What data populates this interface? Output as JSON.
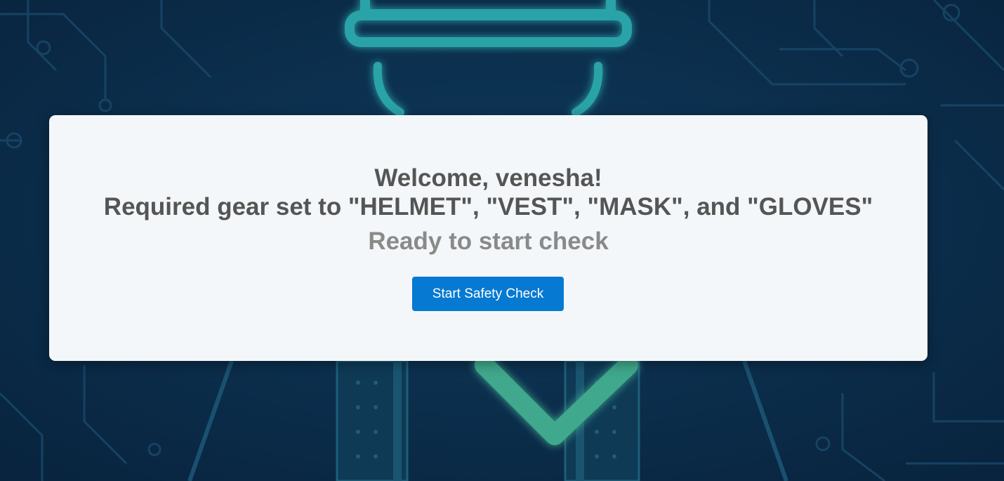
{
  "welcome_card": {
    "greeting": "Welcome, venesha!",
    "required_gear_message": "Required gear set to \"HELMET\", \"VEST\", \"MASK\", and \"GLOVES\"",
    "status_text": "Ready to start check",
    "start_button_label": "Start Safety Check"
  },
  "colors": {
    "background": "#0b2a47",
    "card_background": "#f4f7f9",
    "heading_text": "#555555",
    "status_text": "#8a8a8a",
    "button_background": "#0679d2",
    "button_text": "#ffffff",
    "glow_accent": "#2fb8b0"
  },
  "background_illustration": {
    "icon_name": "safety-worker-helmet-vest-icon"
  }
}
